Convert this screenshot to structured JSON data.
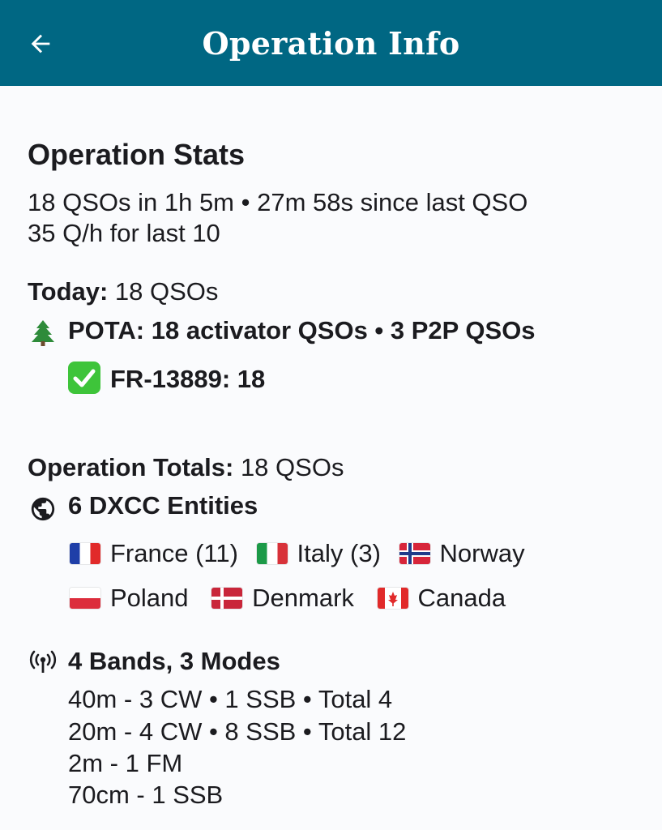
{
  "appbar": {
    "title": "Operation Info",
    "back_icon": "arrow-left-icon",
    "color": "#006783"
  },
  "stats": {
    "heading": "Operation Stats",
    "line1": "18 QSOs in 1h 5m • 27m 58s since last QSO",
    "line2": "35 Q/h for last 10"
  },
  "today": {
    "label": "Today:",
    "value": " 18 QSOs",
    "pota_icon": "evergreen-tree-icon",
    "pota_text": "POTA: 18 activator QSOs • 3 P2P QSOs",
    "park_icon": "check-mark-icon",
    "park_text": "FR-13889: 18"
  },
  "totals": {
    "label": "Operation Totals:",
    "value": " 18 QSOs",
    "dxcc_icon": "globe-icon",
    "dxcc_text": "6 DXCC Entities",
    "countries": [
      {
        "name": "France (11)",
        "flag": "flag-france-icon"
      },
      {
        "name": "Italy (3)",
        "flag": "flag-italy-icon"
      },
      {
        "name": "Norway",
        "flag": "flag-norway-icon"
      },
      {
        "name": "Poland",
        "flag": "flag-poland-icon"
      },
      {
        "name": "Denmark",
        "flag": "flag-denmark-icon"
      },
      {
        "name": "Canada",
        "flag": "flag-canada-icon"
      }
    ],
    "bands_icon": "antenna-icon",
    "bands_text": "4 Bands, 3 Modes",
    "bands": [
      "40m -  3 CW • 1 SSB • Total 4",
      "20m -  4 CW • 8 SSB • Total 12",
      "2m -  1 FM",
      "70cm -  1 SSB"
    ]
  }
}
